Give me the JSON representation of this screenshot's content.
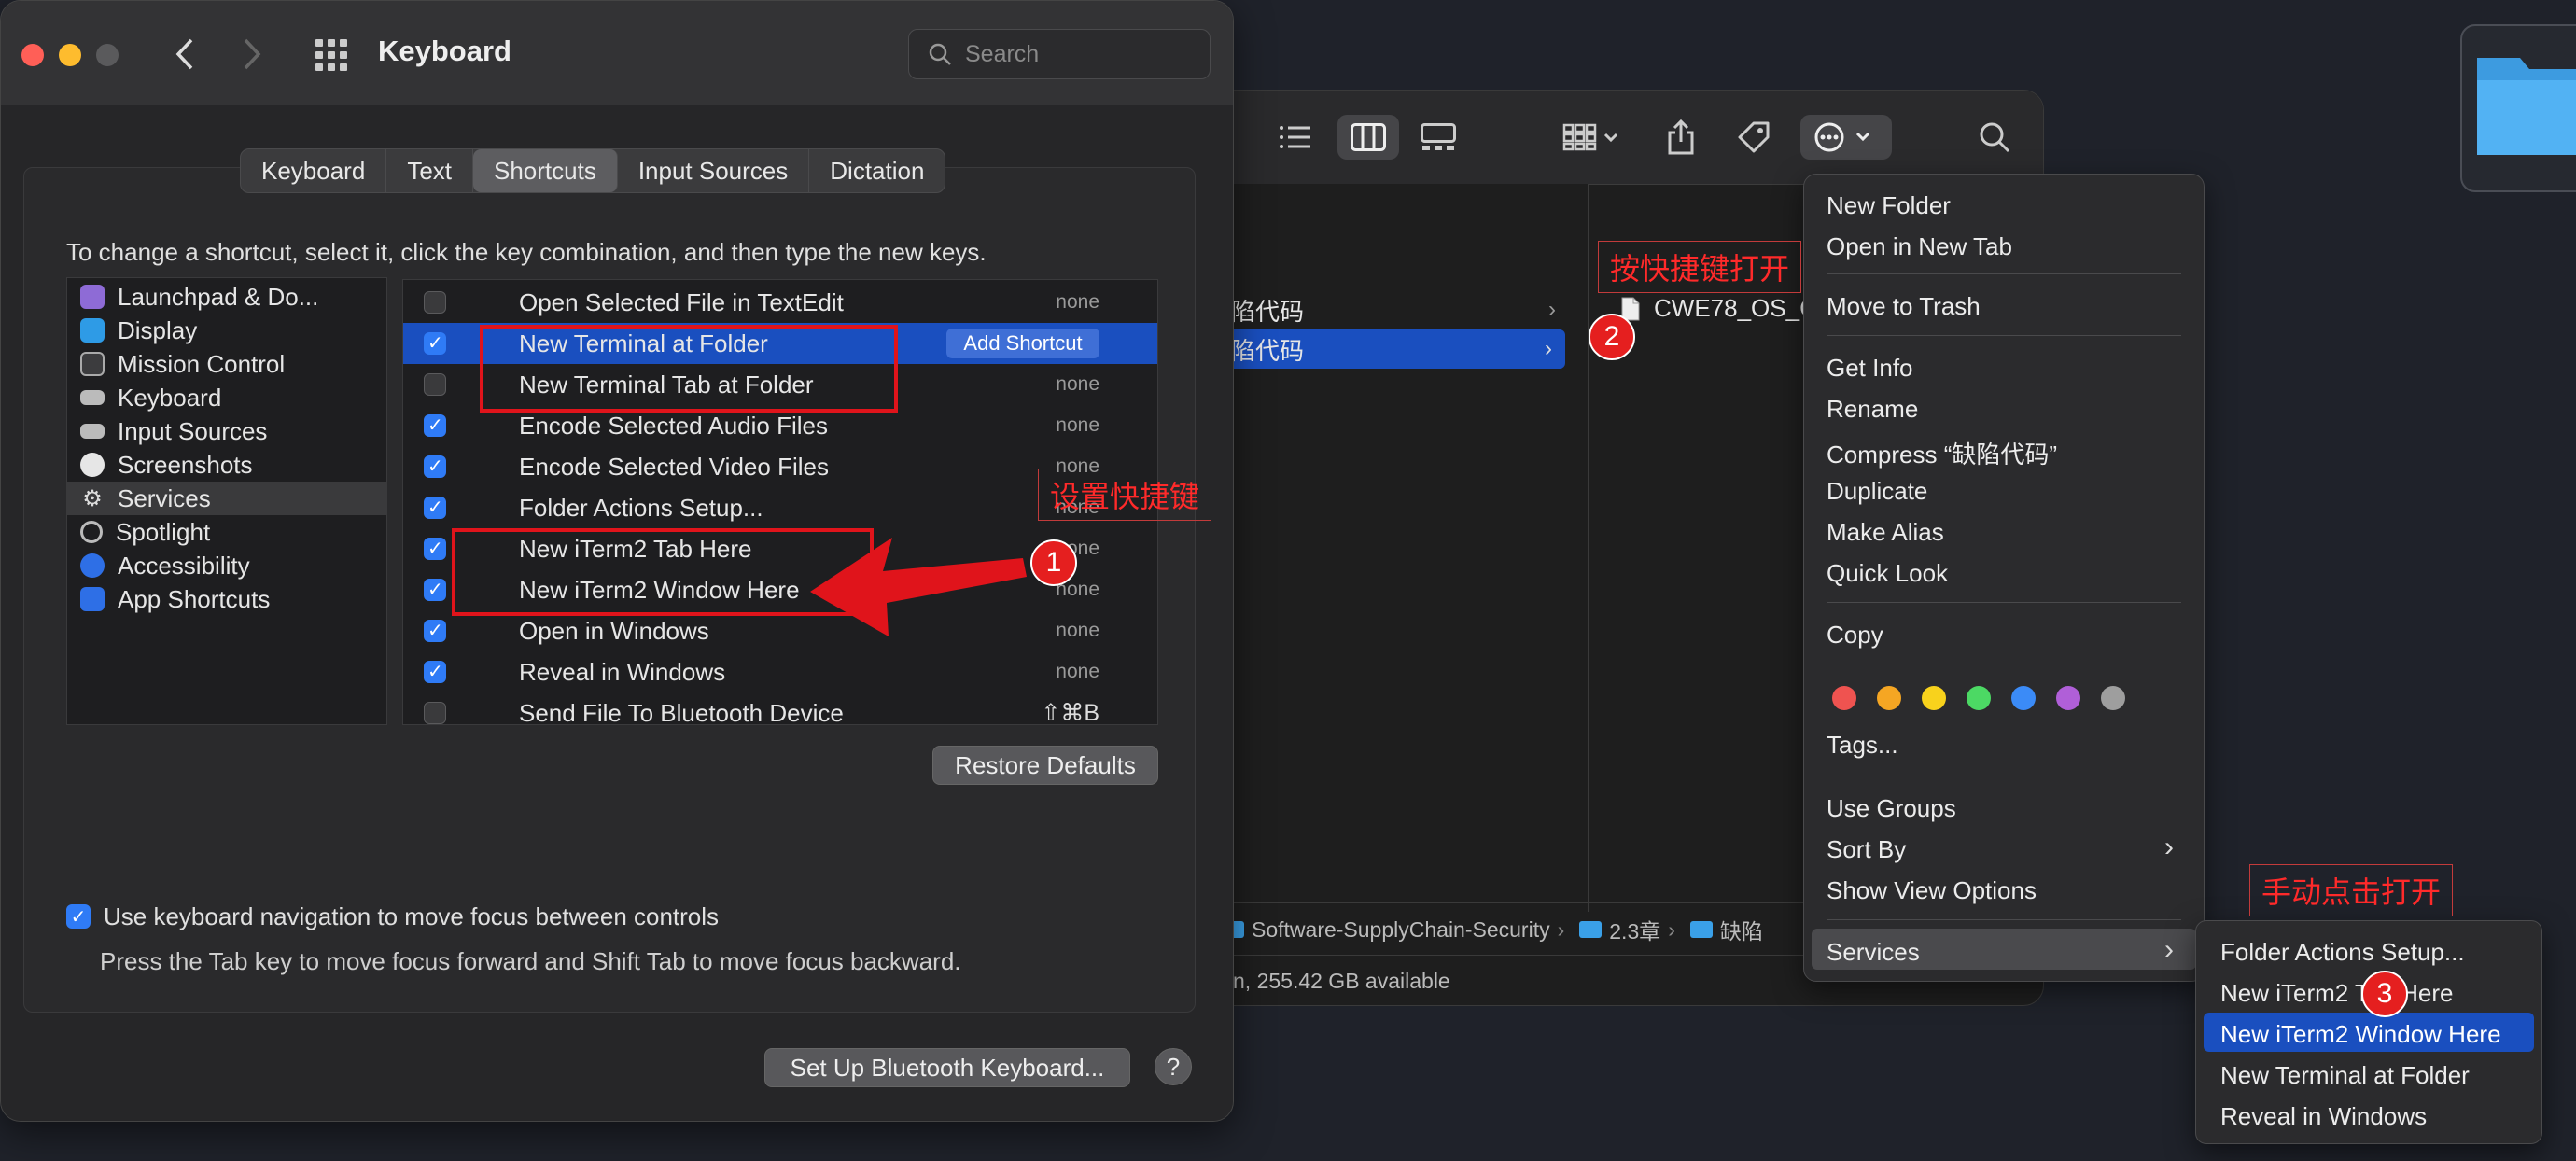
{
  "syspref": {
    "title": "Keyboard",
    "search_placeholder": "Search",
    "tabs": [
      "Keyboard",
      "Text",
      "Shortcuts",
      "Input Sources",
      "Dictation"
    ],
    "selected_tab": "Shortcuts",
    "instructions": "To change a shortcut, select it, click the key combination, and then type the new keys.",
    "sidebar": [
      {
        "label": "Launchpad & Do...",
        "icon": "launchpad-icon",
        "color": "#8e6bd6"
      },
      {
        "label": "Display",
        "icon": "display-icon",
        "color": "#2e9be6"
      },
      {
        "label": "Mission Control",
        "icon": "mission-control-icon",
        "color": "#444"
      },
      {
        "label": "Keyboard",
        "icon": "keyboard-icon",
        "color": "#777"
      },
      {
        "label": "Input Sources",
        "icon": "input-sources-icon",
        "color": "#777"
      },
      {
        "label": "Screenshots",
        "icon": "screenshots-icon",
        "color": "#666"
      },
      {
        "label": "Services",
        "icon": "gear-icon",
        "color": "#555"
      },
      {
        "label": "Spotlight",
        "icon": "spotlight-icon",
        "color": "#555"
      },
      {
        "label": "Accessibility",
        "icon": "accessibility-icon",
        "color": "#2e6fe6"
      },
      {
        "label": "App Shortcuts",
        "icon": "app-shortcuts-icon",
        "color": "#2e6fe6"
      }
    ],
    "services": [
      {
        "name": "Open Selected File in TextEdit",
        "checked": false,
        "shortcut": "none"
      },
      {
        "name": "New Terminal at Folder",
        "checked": true,
        "shortcut": "Add Shortcut",
        "selected": true
      },
      {
        "name": "New Terminal Tab at Folder",
        "checked": false,
        "shortcut": "none"
      },
      {
        "name": "Encode Selected Audio Files",
        "checked": true,
        "shortcut": "none"
      },
      {
        "name": "Encode Selected Video Files",
        "checked": true,
        "shortcut": "none"
      },
      {
        "name": "Folder Actions Setup...",
        "checked": true,
        "shortcut": "none"
      },
      {
        "name": "New iTerm2 Tab Here",
        "checked": true,
        "shortcut": "none"
      },
      {
        "name": "New iTerm2 Window Here",
        "checked": true,
        "shortcut": "none"
      },
      {
        "name": "Open in Windows",
        "checked": true,
        "shortcut": "none"
      },
      {
        "name": "Reveal in Windows",
        "checked": true,
        "shortcut": "none"
      },
      {
        "name": "Send File To Bluetooth Device",
        "checked": false,
        "shortcut": "⇧⌘B"
      }
    ],
    "restore_defaults": "Restore Defaults",
    "kbd_nav_label": "Use keyboard navigation to move focus between controls",
    "kbd_nav_checked": true,
    "kbd_nav_hint": "Press the Tab key to move focus forward and Shift Tab to move focus backward.",
    "bluetooth_button": "Set Up Bluetooth Keyboard...",
    "help_button": "?"
  },
  "finder": {
    "col1_items": [
      {
        "label": "缺陷代码",
        "selected": false
      },
      {
        "label": "缺陷代码",
        "selected": true
      }
    ],
    "col2_file": "CWE78_OS_C",
    "path": [
      "Software-SupplyChain-Security",
      "2.3章",
      "缺陷"
    ],
    "status": "n, 255.42 GB available"
  },
  "context_menu": {
    "items_group1": [
      "New Folder",
      "Open in New Tab"
    ],
    "items_group2": [
      "Move to Trash"
    ],
    "items_group3": [
      "Get Info",
      "Rename",
      "Compress “缺陷代码”",
      "Duplicate",
      "Make Alias",
      "Quick Look"
    ],
    "items_group4": [
      "Copy"
    ],
    "tag_colors": [
      "#ef5350",
      "#f5a623",
      "#f8d21c",
      "#4cd964",
      "#3b8bf7",
      "#b05fd8",
      "#9e9e9e"
    ],
    "tags_label": "Tags...",
    "items_group5": [
      "Use Groups",
      "Sort By",
      "Show View Options"
    ],
    "services_label": "Services"
  },
  "services_submenu": [
    "Folder Actions Setup...",
    "New iTerm2 Tab Here",
    "New iTerm2 Window Here",
    "New Terminal at Folder",
    "Reveal in Windows"
  ],
  "annotations": {
    "label1": "设置快捷键",
    "label2": "按快捷键打开",
    "label3": "手动点击打开",
    "badge1": "1",
    "badge2": "2",
    "badge3": "3"
  },
  "colors": {
    "accent": "#1a4fbf",
    "annotation_red": "#e0141b"
  }
}
